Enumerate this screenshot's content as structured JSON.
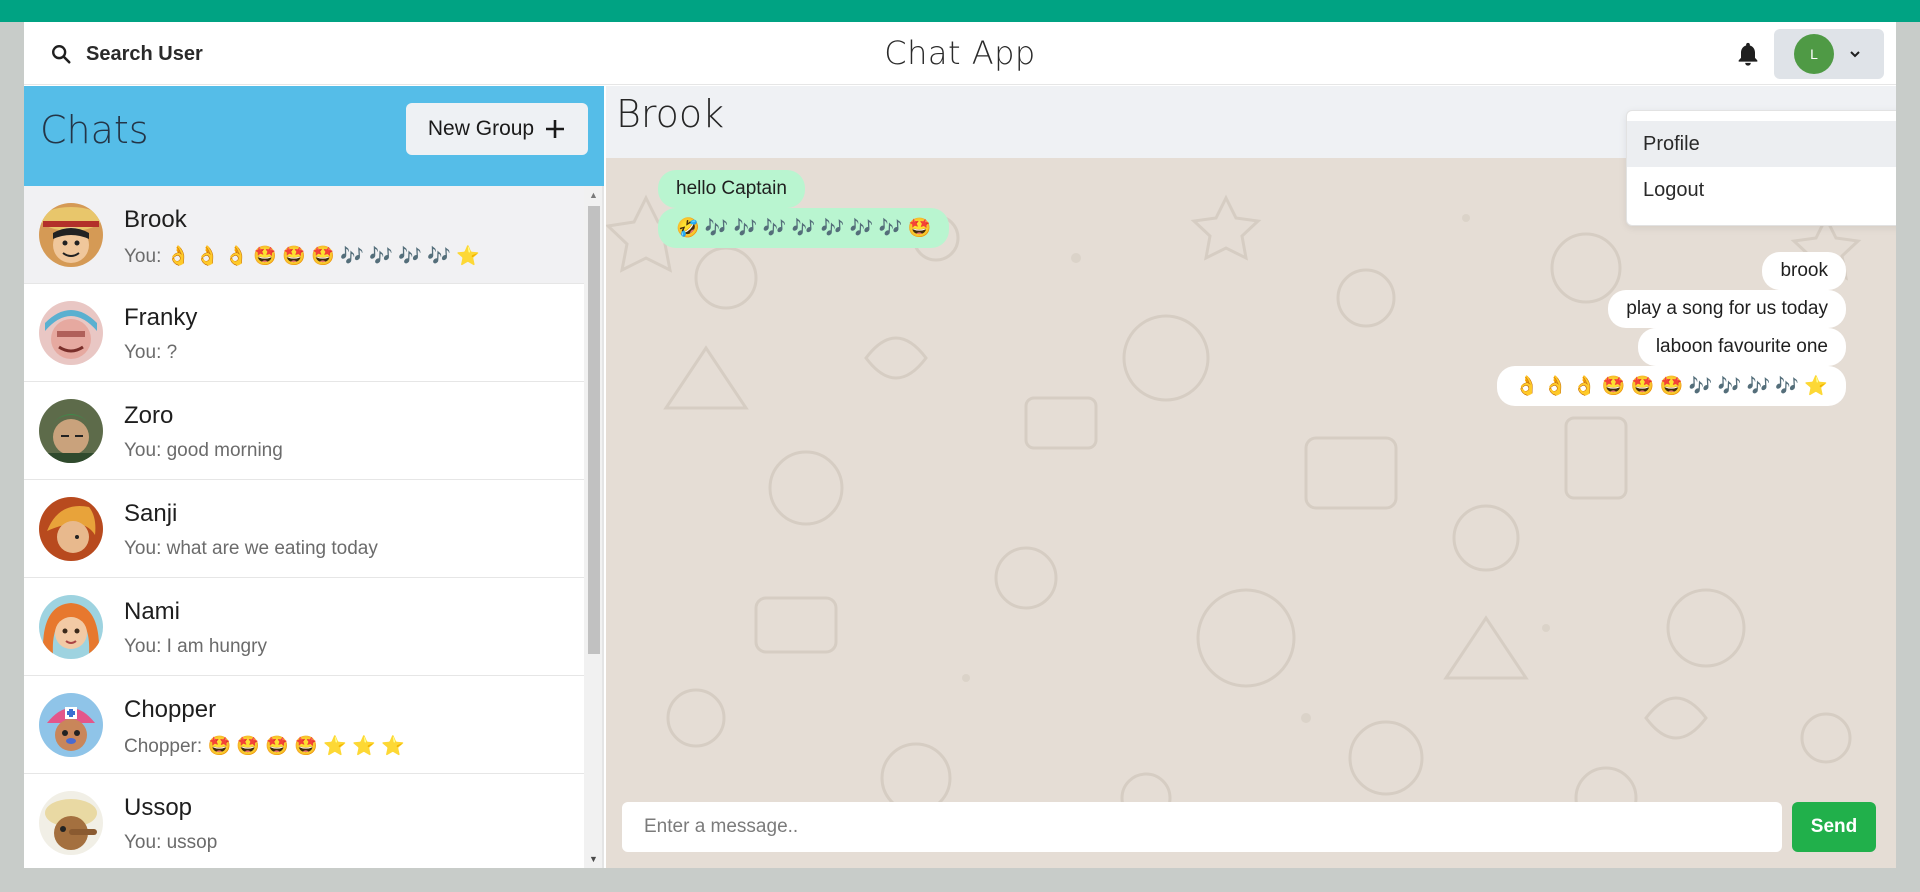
{
  "header": {
    "search_label": "Search User",
    "app_title": "Chat App",
    "avatar_initial": "L"
  },
  "sidebar": {
    "title": "Chats",
    "new_group_label": "New Group",
    "chats": [
      {
        "name": "Brook",
        "preview": "You: 👌 👌 👌 🤩 🤩 🤩 🎶 🎶 🎶 🎶 ⭐",
        "active": true
      },
      {
        "name": "Franky",
        "preview": "You: ?"
      },
      {
        "name": "Zoro",
        "preview": "You: good morning"
      },
      {
        "name": "Sanji",
        "preview": "You: what are we eating today"
      },
      {
        "name": "Nami",
        "preview": "You: I am hungry"
      },
      {
        "name": "Chopper",
        "preview": "Chopper: 🤩 🤩 🤩 🤩 ⭐ ⭐ ⭐"
      },
      {
        "name": "Ussop",
        "preview": "You: ussop"
      }
    ]
  },
  "chat": {
    "title": "Brook",
    "messages": [
      {
        "text": "hello Captain",
        "from": "them"
      },
      {
        "text": "🤣 🎶 🎶 🎶 🎶 🎶 🎶 🎶 🤩",
        "from": "them"
      },
      {
        "text": "brook",
        "from": "me"
      },
      {
        "text": "play a song for us today",
        "from": "me"
      },
      {
        "text": "laboon favourite one",
        "from": "me"
      },
      {
        "text": "👌 👌 👌 🤩 🤩 🤩 🎶 🎶 🎶 🎶 ⭐",
        "from": "me"
      }
    ],
    "input_placeholder": "Enter a message..",
    "send_label": "Send"
  },
  "menu": {
    "items": [
      "Profile",
      "Logout"
    ]
  },
  "colors": {
    "top_band": "#00a383",
    "sidebar_header": "#55bde8",
    "send_button": "#21b04b",
    "incoming_bubble": "#b9f5d0",
    "chat_background": "#e5ddd5"
  },
  "icons": {
    "search": "search-icon",
    "bell": "bell-icon",
    "chevron": "chevron-down-icon",
    "plus": "plus-icon"
  }
}
